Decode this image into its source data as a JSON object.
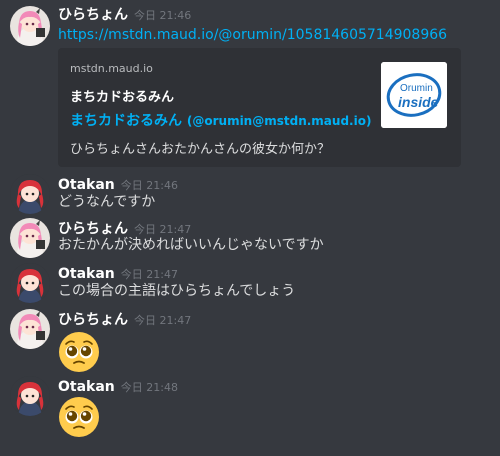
{
  "messages": [
    {
      "author": "ひらちょん",
      "time": "今日 21:46",
      "link": "https://mstdn.maud.io/@orumin/105814605714908966",
      "embed": {
        "provider": "mstdn.maud.io",
        "author": "まちカドおるみん",
        "title": "まちカドおるみん",
        "handle": "(@orumin@mstdn.maud.io)",
        "description": "ひらちょんさんおたかんさんの彼女か何か？",
        "thumb_text": [
          "Orumin",
          "inside"
        ]
      }
    },
    {
      "author": "Otakan",
      "time": "今日 21:46",
      "text": "どうなんですか"
    },
    {
      "author": "ひらちょん",
      "time": "今日 21:47",
      "text": "おたかんが決めればいいんじゃないですか"
    },
    {
      "author": "Otakan",
      "time": "今日 21:47",
      "text": "この場合の主語はひらちょんでしょう"
    },
    {
      "author": "ひらちょん",
      "time": "今日 21:47",
      "emoji": "pleading-face-emoji"
    },
    {
      "author": "Otakan",
      "time": "今日 21:48",
      "emoji": "pleading-face-emoji"
    }
  ],
  "colors": {
    "background": "#36393f",
    "embed_background": "#2f3136",
    "link": "#00b0f4",
    "timestamp": "#72767d",
    "author": "#ffffff",
    "text": "#dcddde"
  }
}
